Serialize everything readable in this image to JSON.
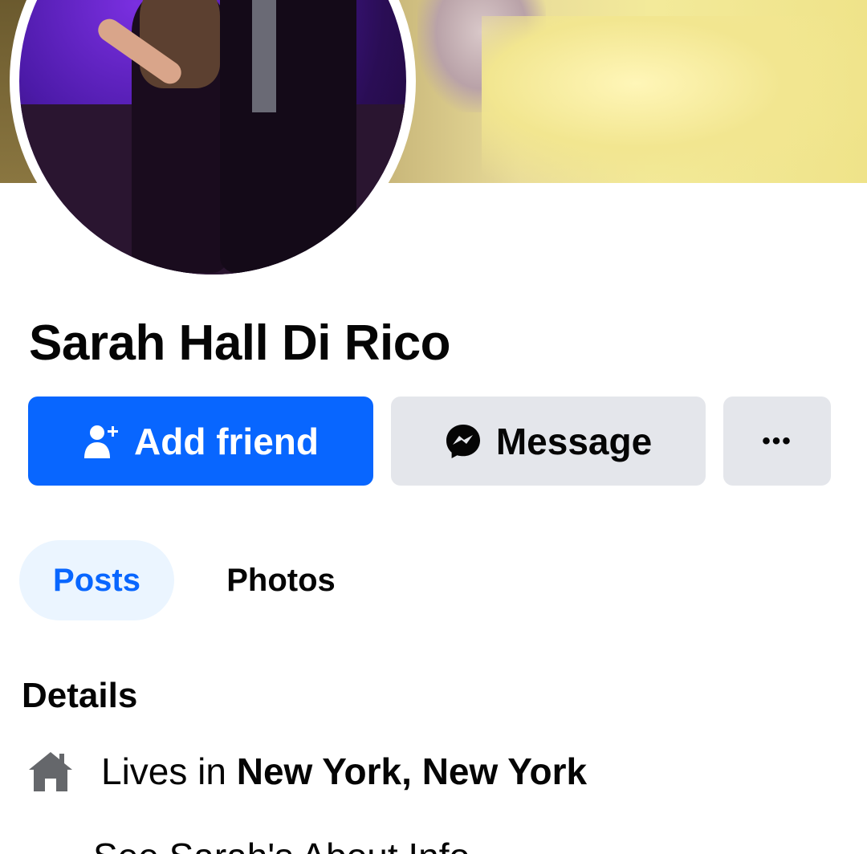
{
  "profile": {
    "name": "Sarah Hall Di Rico"
  },
  "actions": {
    "add_friend_label": "Add friend",
    "message_label": "Message",
    "more_label": "•••"
  },
  "tabs": [
    {
      "label": "Posts",
      "selected": true
    },
    {
      "label": "Photos",
      "selected": false
    }
  ],
  "details": {
    "title": "Details",
    "lives_in_prefix": "Lives in ",
    "lives_in_place": "New York, New York",
    "see_about_label": "See Sarah's About Info"
  },
  "colors": {
    "primary": "#0866ff",
    "secondary_button": "#e4e6eb",
    "selected_tab_bg": "#ebf5ff",
    "text": "#050505"
  },
  "icons": {
    "add_friend": "person-add-icon",
    "message": "messenger-icon",
    "more": "more-dots-icon",
    "lives_in": "home-icon"
  }
}
